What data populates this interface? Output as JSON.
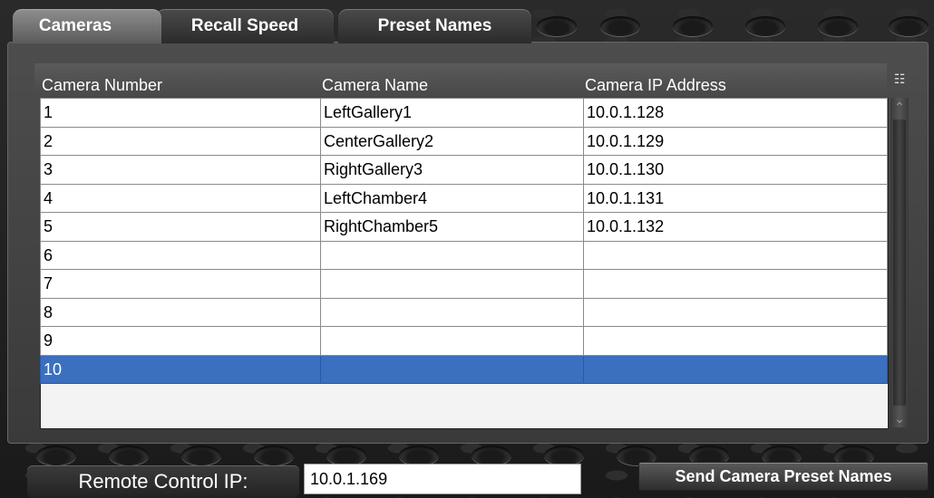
{
  "tabs": [
    {
      "label": "Cameras",
      "active": true
    },
    {
      "label": "Recall Speed",
      "active": false
    },
    {
      "label": "Preset Names",
      "active": false
    }
  ],
  "table": {
    "columns": [
      "Camera Number",
      "Camera Name",
      "Camera IP Address"
    ],
    "rows": [
      {
        "number": "1",
        "name": "LeftGallery1",
        "ip": "10.0.1.128"
      },
      {
        "number": "2",
        "name": "CenterGallery2",
        "ip": "10.0.1.129"
      },
      {
        "number": "3",
        "name": "RightGallery3",
        "ip": "10.0.1.130"
      },
      {
        "number": "4",
        "name": "LeftChamber4",
        "ip": "10.0.1.131"
      },
      {
        "number": "5",
        "name": "RightChamber5",
        "ip": "10.0.1.132"
      },
      {
        "number": "6",
        "name": "",
        "ip": ""
      },
      {
        "number": "7",
        "name": "",
        "ip": ""
      },
      {
        "number": "8",
        "name": "",
        "ip": ""
      },
      {
        "number": "9",
        "name": "",
        "ip": ""
      },
      {
        "number": "10",
        "name": "",
        "ip": ""
      }
    ],
    "selected_row": "10",
    "selection_color": "#3b6fbf"
  },
  "icons": {
    "column_picker": "column-picker-icon",
    "scroll_up": "chevron-up-icon",
    "scroll_down": "chevron-down-icon"
  },
  "remote": {
    "label": "Remote Control IP:",
    "value": "10.0.1.169"
  },
  "send_button": {
    "label": "Send Camera Preset Names"
  }
}
